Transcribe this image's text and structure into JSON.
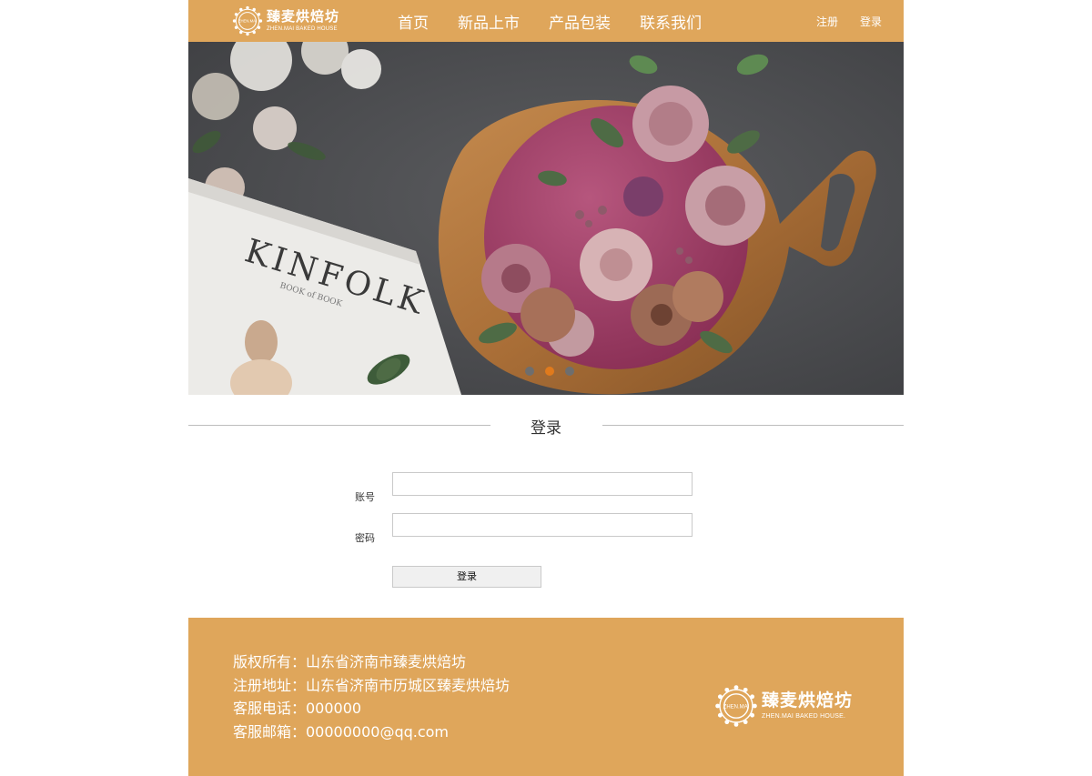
{
  "header": {
    "logo": {
      "name": "臻麦烘焙坊",
      "subtitle": "ZHEN.MAI BAKED HOUSE",
      "badge_text": "ZHEN.MAI"
    },
    "nav": [
      {
        "label": "首页"
      },
      {
        "label": "新品上市"
      },
      {
        "label": "产品包装"
      },
      {
        "label": "联系我们"
      }
    ],
    "user_links": {
      "register": "注册",
      "login": "登录"
    }
  },
  "banner": {
    "book_text": "KINFOLK",
    "book_subtext": "BOOK of BOOK",
    "slide_count": 3,
    "active_slide": 2,
    "colors": {
      "accent": "#e07a1c",
      "inactive": "#6e6e6e"
    }
  },
  "login_section": {
    "title": "登录",
    "account_label": "账号",
    "account_value": "",
    "password_label": "密码",
    "password_value": "",
    "submit_label": "登录"
  },
  "footer": {
    "lines": [
      "版权所有：山东省济南市臻麦烘焙坊",
      "注册地址：山东省济南市历城区臻麦烘焙坊",
      "客服电话：000000",
      "客服邮箱：00000000@qq.com"
    ],
    "logo": {
      "name": "臻麦烘焙坊",
      "subtitle": "ZHEN.MAI BAKED HOUSE."
    }
  },
  "colors": {
    "brand": "#dfa65b",
    "text_on_brand": "#ffffff"
  }
}
